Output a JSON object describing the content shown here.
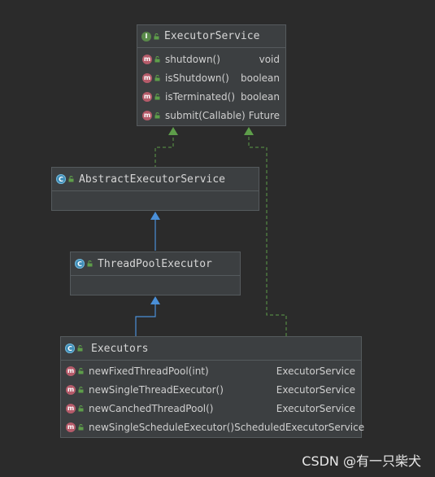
{
  "executor_service": {
    "title": "ExecutorService",
    "kind_icon": "interface-icon",
    "methods": [
      {
        "name": "shutdown()",
        "type": "void"
      },
      {
        "name": "isShutdown()",
        "type": "boolean"
      },
      {
        "name": "isTerminated()",
        "type": "boolean"
      },
      {
        "name": "submit(Callable)",
        "type": "Future"
      }
    ]
  },
  "abstract_executor_service": {
    "title": "AbstractExecutorService",
    "kind_icon": "abstract-class-icon"
  },
  "thread_pool_executor": {
    "title": "ThreadPoolExecutor",
    "kind_icon": "class-icon"
  },
  "executors": {
    "title": "Executors",
    "kind_icon": "class-icon",
    "methods": [
      {
        "name": "newFixedThreadPool(int)",
        "type": "ExecutorService"
      },
      {
        "name": "newSingleThreadExecutor()",
        "type": "ExecutorService"
      },
      {
        "name": "newCanchedThreadPool()",
        "type": "ExecutorService"
      },
      {
        "name": "newSingleScheduleExecutor()",
        "type": "ScheduledExecutorService"
      }
    ]
  },
  "relations": [
    {
      "from": "AbstractExecutorService",
      "to": "ExecutorService",
      "kind": "implements"
    },
    {
      "from": "ThreadPoolExecutor",
      "to": "AbstractExecutorService",
      "kind": "extends"
    },
    {
      "from": "Executors",
      "to": "ThreadPoolExecutor",
      "kind": "extends"
    },
    {
      "from": "Executors",
      "to": "ExecutorService",
      "kind": "implements"
    }
  ],
  "colors": {
    "background": "#2b2b2b",
    "box": "#3c3f41",
    "implements_line": "#5e9e4a",
    "extends_line": "#4a8fd8"
  },
  "watermark": "CSDN @有一只柴犬"
}
